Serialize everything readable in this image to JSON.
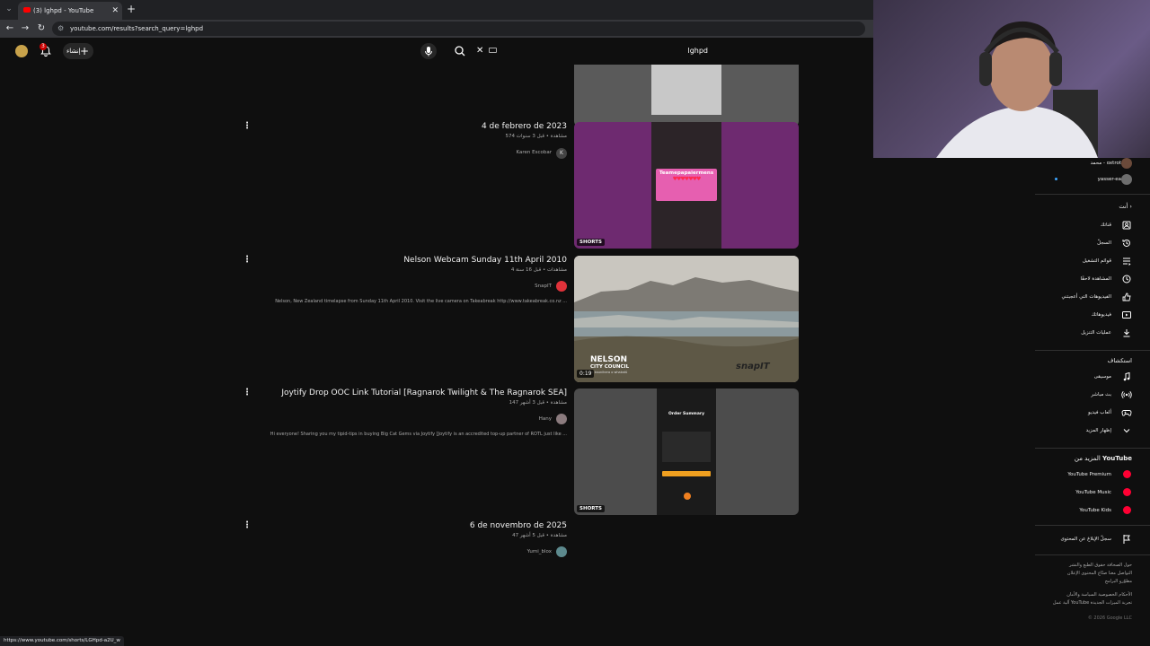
{
  "browser": {
    "tab_title": "(3) lghpd - YouTube",
    "url": "youtube.com/results?search_query=lghpd",
    "status_url": "https://www.youtube.com/shorts/LGHpd-a2U_w"
  },
  "masthead": {
    "notification_count": "3",
    "create_label": "إنشاء",
    "search_query": "lghpd"
  },
  "results": [
    {
      "title": "4 de febrero de 2023",
      "meta": "574 مشاهدة • قبل 3 سنوات",
      "channel": "Karen Escobar",
      "channel_initial": "K",
      "badge": "SHORTS",
      "thumb_text": "Teamepapaiermens",
      "kind": "short-pink"
    },
    {
      "title": "Nelson Webcam Sunday 11th April 2010",
      "meta": "4 مشاهدات • قبل 16 سنة",
      "channel": "SnapIT",
      "description": "Nelson, New Zealand timelapse from Sunday 11th April 2010. Visit the live camera on Takeabreak http://www.takeabreak.co.nz ...",
      "duration": "0:19",
      "overlay_brand": "NELSON",
      "overlay_sub": "CITY COUNCIL",
      "overlay_sub2": "te kaunihera o whakatū",
      "overlay_brand2": "snapIT",
      "kind": "webcam"
    },
    {
      "title": "Joytify Drop OOC Link Tutorial [Ragnarok Twilight & The Ragnarok SEA]",
      "meta": "147 مشاهدة • قبل 3 أشهر",
      "channel": "Hany",
      "description": "Hi everyone! Sharing you my tipid-tips in buying Big Cat Gems via Joytify [Joytify is an accredited top-up partner of ROTL just like ...",
      "badge": "SHORTS",
      "thumb_text": "Order Summary",
      "kind": "short-phone"
    },
    {
      "title": "6 de novembro de 2025",
      "meta": "47 مشاهدة • قبل 5 أشهر",
      "channel": "Yumi_blox",
      "kind": "text-only"
    }
  ],
  "sidebar": {
    "subs": [
      {
        "label": "محمد - oxtrot"
      },
      {
        "label": "yasser-ea"
      }
    ],
    "you_heading": "أنت",
    "you_items": [
      {
        "label": "قناتك",
        "icon": "person-box-icon"
      },
      {
        "label": "السجلّ",
        "icon": "history-icon"
      },
      {
        "label": "قوائم التشغيل",
        "icon": "playlist-icon"
      },
      {
        "label": "المشاهدة لاحقًا",
        "icon": "clock-icon"
      },
      {
        "label": "الفيديوهات التي أعجبتني",
        "icon": "thumbs-up-icon"
      },
      {
        "label": "فيديوهاتك",
        "icon": "video-play-icon"
      },
      {
        "label": "عمليات التنزيل",
        "icon": "download-icon"
      }
    ],
    "explore_heading": "استكشاف",
    "explore_items": [
      {
        "label": "موسيقى",
        "icon": "music-note-icon"
      },
      {
        "label": "بث مباشر",
        "icon": "live-icon"
      },
      {
        "label": "ألعاب فيديو",
        "icon": "gamepad-icon"
      },
      {
        "label": "إظهار المزيد",
        "icon": "chevron-down-icon"
      }
    ],
    "more_heading_prefix": "المزيد من",
    "more_heading_brand": "YouTube",
    "more_items": [
      {
        "label": "YouTube Premium",
        "color": "#ff0033"
      },
      {
        "label": "YouTube Music",
        "color": "#ff0033"
      },
      {
        "label": "YouTube Kids",
        "color": "#ff0033"
      }
    ],
    "report_label": "سجلّ الإبلاغ عن المحتوى",
    "footer1": "حول   الصحافة   حقوق الطبع والنشر",
    "footer2": "التواصل معنا   صنّاع المحتوى   الإعلان",
    "footer3": "مطوّرو البرامج",
    "footer4": "الأحكام   الخصوصية   السياسة والأمان",
    "footer5": "آلية عمل YouTube   تجربة الميزات الجديدة",
    "copyright": "© 2026 Google LLC"
  }
}
